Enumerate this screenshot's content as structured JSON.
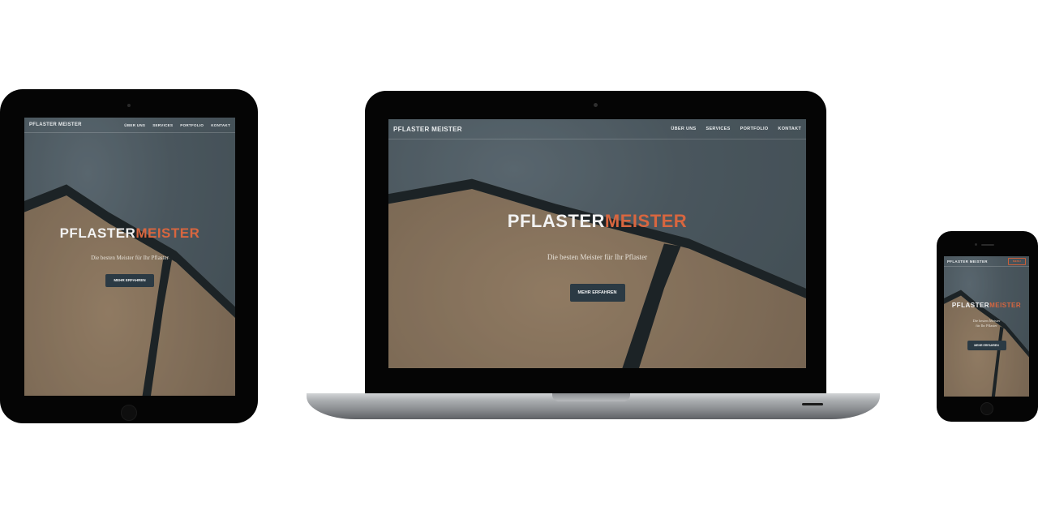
{
  "site": {
    "brand": "PFLASTER MEISTER",
    "hero_title_part1": "PFLASTER",
    "hero_title_part2": "MEISTER",
    "hero_subtitle": "Die besten Meister für Ihr Pflaster",
    "hero_subtitle_phone": [
      "Die besten Meister",
      "für Ihr Pflaster"
    ],
    "cta_label": "MEHR ERFAHREN",
    "nav_items": [
      "ÜBER UNS",
      "SERVICES",
      "PORTFOLIO",
      "KONTAKT"
    ],
    "phone_menu_label": "MENU"
  },
  "colors": {
    "accent": "#d8663f",
    "button": "#2b3a44",
    "device_frame": "#050505"
  }
}
